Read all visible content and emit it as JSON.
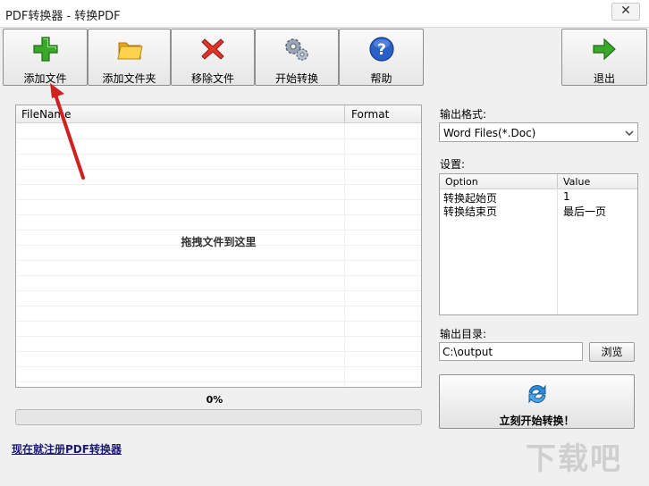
{
  "window": {
    "title": "PDF转换器 - 转换PDF",
    "close_glyph": "✕"
  },
  "toolbar": {
    "add_file": "添加文件",
    "add_folder": "添加文件夹",
    "remove_file": "移除文件",
    "start_convert": "开始转换",
    "help": "帮助",
    "exit": "退出"
  },
  "file_list": {
    "columns": [
      "FileName",
      "Format"
    ],
    "empty_hint": "拖拽文件到这里"
  },
  "progress": {
    "percent_label": "0%",
    "value": 0
  },
  "register_link": "现在就注册PDF转换器",
  "output_format": {
    "label": "输出格式:",
    "selected": "Word Files(*.Doc)"
  },
  "settings": {
    "label": "设置:",
    "columns": [
      "Option",
      "Value"
    ],
    "rows": [
      {
        "option": "转换起始页",
        "value": "1"
      },
      {
        "option": "转换结束页",
        "value": "最后一页"
      }
    ]
  },
  "output_dir": {
    "label": "输出目录:",
    "value": "C:\\output",
    "browse": "浏览"
  },
  "convert_now": "立刻开始转换！",
  "watermark": "下载吧",
  "colors": {
    "accent_green": "#3aa829",
    "arrow_red": "#d02020",
    "help_blue": "#2a5fc8"
  }
}
